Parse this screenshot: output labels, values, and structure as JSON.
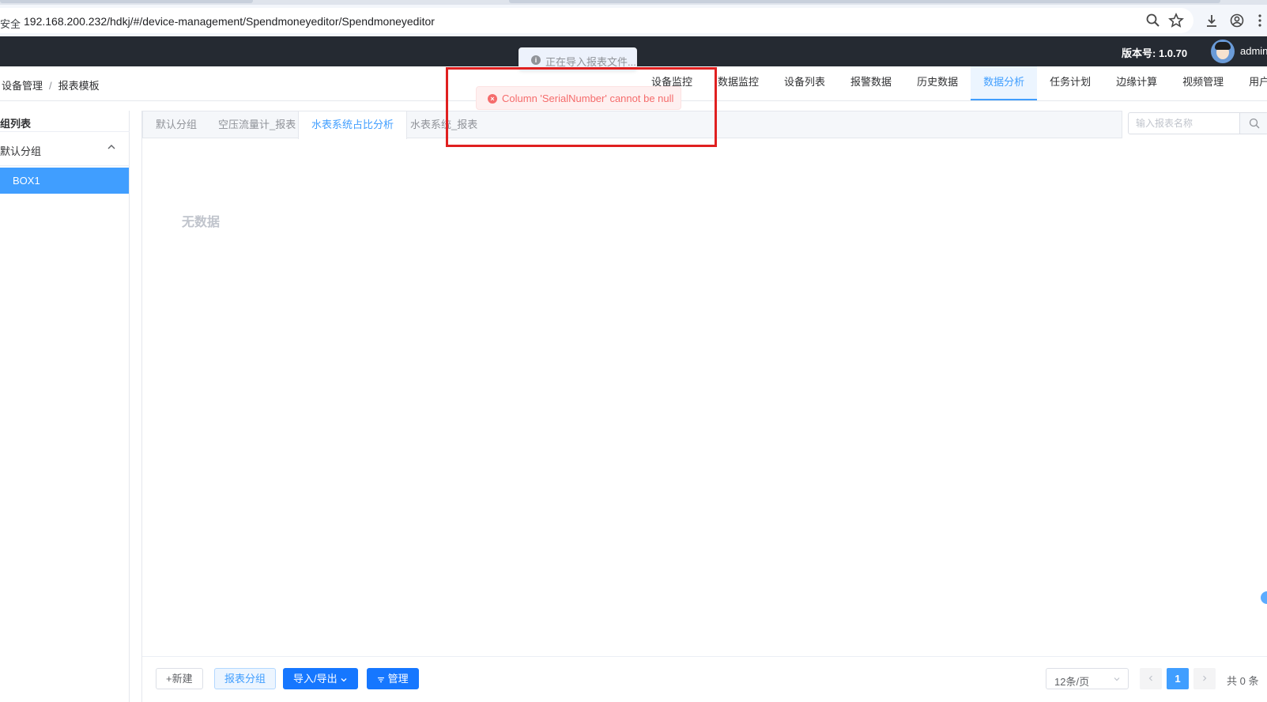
{
  "browser": {
    "url_prefix": "安全",
    "url": "192.168.200.232/hdkj/#/device-management/Spendmoneyeditor/Spendmoneyeditor",
    "icons": [
      "zoom-icon",
      "star-icon",
      "download-icon",
      "profile-icon",
      "menu-icon"
    ]
  },
  "header": {
    "version": "版本号: 1.0.70",
    "username": "admin"
  },
  "breadcrumb": {
    "items": [
      "设备管理",
      "报表模板"
    ],
    "separator": "/"
  },
  "nav": {
    "items": [
      "设备监控",
      "数据监控",
      "设备列表",
      "报警数据",
      "历史数据",
      "数据分析",
      "任务计划",
      "边缘计算",
      "视频管理",
      "用户报告"
    ],
    "active_index": 5
  },
  "left_panel": {
    "title": "组列表",
    "group": "默认分组",
    "item": "BOX1"
  },
  "tabs": {
    "items": [
      "默认分组",
      "空压流量计_报表",
      "水表系统占比分析",
      "水表系统_报表"
    ],
    "active_index": 2
  },
  "search": {
    "value": "",
    "placeholder": "输入报表名称"
  },
  "content": {
    "empty_text": "无数据"
  },
  "footer": {
    "new_label": "+新建",
    "group_label": "报表分组",
    "io_label": "导入/导出",
    "manage_label": "管理",
    "page_size": "12条/页",
    "current_page": "1",
    "total": "共 0 条"
  },
  "toasts": {
    "loading": "正在导入报表文件...",
    "error": "Column 'SerialNumber' cannot be null"
  },
  "colors": {
    "primary": "#409eff",
    "header_bg": "#252a32",
    "error": "#f56c6c",
    "highlight_border": "#e02020"
  }
}
